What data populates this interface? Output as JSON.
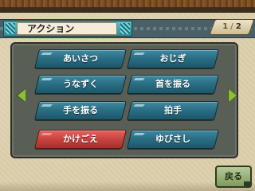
{
  "header": {
    "title": "アクション",
    "page": {
      "current": "1",
      "separator": "/",
      "total": "2"
    }
  },
  "actions": [
    {
      "label": "あいさつ",
      "color": "#2a6f86"
    },
    {
      "label": "おじぎ",
      "color": "#2a6f86"
    },
    {
      "label": "うなずく",
      "color": "#2a6f86"
    },
    {
      "label": "首を振る",
      "color": "#2a6f86"
    },
    {
      "label": "手を振る",
      "color": "#2a6f86"
    },
    {
      "label": "拍手",
      "color": "#2a6f86"
    },
    {
      "label": "かけごえ",
      "color": "#c8433f"
    },
    {
      "label": "ゆびさし",
      "color": "#2a6f86"
    }
  ],
  "footer": {
    "back_label": "戻る"
  },
  "icons": {
    "prev": "left-arrow-icon",
    "next": "right-arrow-icon"
  }
}
